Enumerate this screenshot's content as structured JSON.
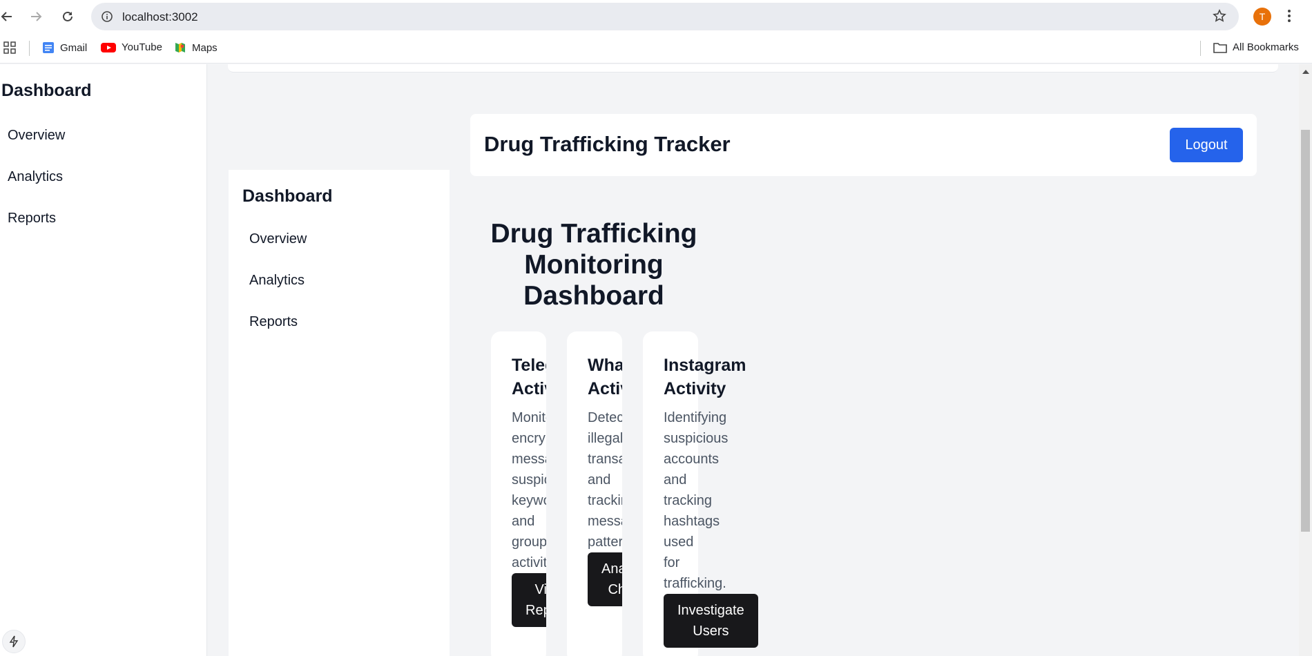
{
  "browser": {
    "url": "localhost:3002",
    "profile_initial": "T",
    "bookmarks": [
      "Gmail",
      "YouTube",
      "Maps"
    ],
    "all_bookmarks": "All Bookmarks"
  },
  "left_sidebar": {
    "title": "Dashboard",
    "items": [
      "Overview",
      "Analytics",
      "Reports"
    ]
  },
  "inner_sidebar": {
    "title": "Dashboard",
    "items": [
      "Overview",
      "Analytics",
      "Reports"
    ]
  },
  "header": {
    "title": "Drug Trafficking Tracker",
    "logout_label": "Logout"
  },
  "main": {
    "title_lines": [
      "Drug Trafficking",
      "Monitoring",
      "Dashboard"
    ]
  },
  "cards": [
    {
      "title_lines": [
        "Telegram",
        "Activity"
      ],
      "body_lines": [
        "Monitoring",
        "encrypted",
        "messages,",
        "suspicious",
        "keywords,",
        "and",
        "group",
        "activities."
      ],
      "button_lines": [
        "View",
        "Reports"
      ]
    },
    {
      "title_lines": [
        "WhatsApp",
        "Activity"
      ],
      "body_lines": [
        "Detecting",
        "illegal",
        "transactions",
        "and",
        "tracking",
        "message",
        "patterns."
      ],
      "button_lines": [
        "Analyze",
        "Chats"
      ]
    },
    {
      "title_lines": [
        "Instagram",
        "Activity"
      ],
      "body_lines": [
        "Identifying",
        "suspicious",
        "accounts",
        "and",
        "tracking",
        "hashtags",
        "used",
        "for",
        "trafficking."
      ],
      "button_lines": [
        "Investigate",
        "Users"
      ]
    }
  ]
}
